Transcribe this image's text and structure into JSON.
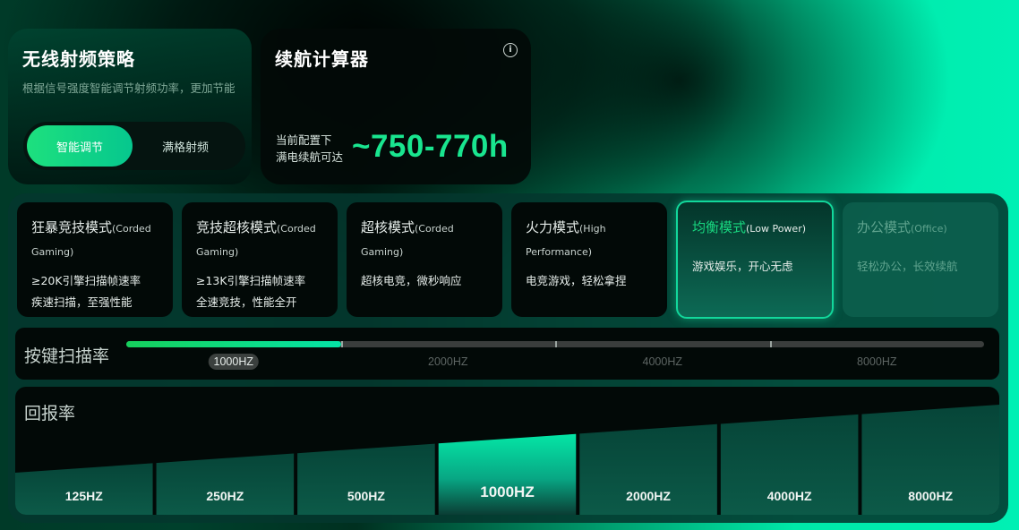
{
  "rf_strategy": {
    "title": "无线射频策略",
    "description": "根据信号强度智能调节射频功率，更加节能",
    "options": [
      {
        "label": "智能调节",
        "active": true
      },
      {
        "label": "满格射频",
        "active": false
      }
    ]
  },
  "battery_calc": {
    "title": "续航计算器",
    "info_icon": "info-icon",
    "caption_line1": "当前配置下",
    "caption_line2": "满电续航可达",
    "value": "~750-770h"
  },
  "modes": [
    {
      "name": "狂暴竞技模式",
      "sub": "(Corded Gaming)",
      "desc1": "≥20K引擎扫描帧速率",
      "desc2": "疾速扫描，至强性能",
      "state": "normal"
    },
    {
      "name": "竞技超核模式",
      "sub": "(Corded Gaming)",
      "desc1": "≥13K引擎扫描帧速率",
      "desc2": "全速竞技，性能全开",
      "state": "normal"
    },
    {
      "name": "超核模式",
      "sub": "(Corded Gaming)",
      "desc1": "超核电竞，微秒响应",
      "desc2": "",
      "state": "normal"
    },
    {
      "name": "火力模式",
      "sub": "(High Performance)",
      "desc1": "电竞游戏，轻松拿捏",
      "desc2": "",
      "state": "normal"
    },
    {
      "name": "均衡模式",
      "sub": "(Low Power)",
      "desc1": "游戏娱乐，开心无虑",
      "desc2": "",
      "state": "active"
    },
    {
      "name": "办公模式",
      "sub": "(Office)",
      "desc1": "轻松办公，长效续航",
      "desc2": "",
      "state": "dim"
    }
  ],
  "scan_rate": {
    "label": "按键扫描率",
    "options": [
      "1000HZ",
      "2000HZ",
      "4000HZ",
      "8000HZ"
    ],
    "selected_index": 0
  },
  "report_rate": {
    "label": "回报率",
    "options": [
      "125HZ",
      "250HZ",
      "500HZ",
      "1000HZ",
      "2000HZ",
      "4000HZ",
      "8000HZ"
    ],
    "selected_index": 3
  },
  "colors": {
    "accent": "#19e58f",
    "active_border": "#12d79b",
    "panel": "#020907"
  }
}
